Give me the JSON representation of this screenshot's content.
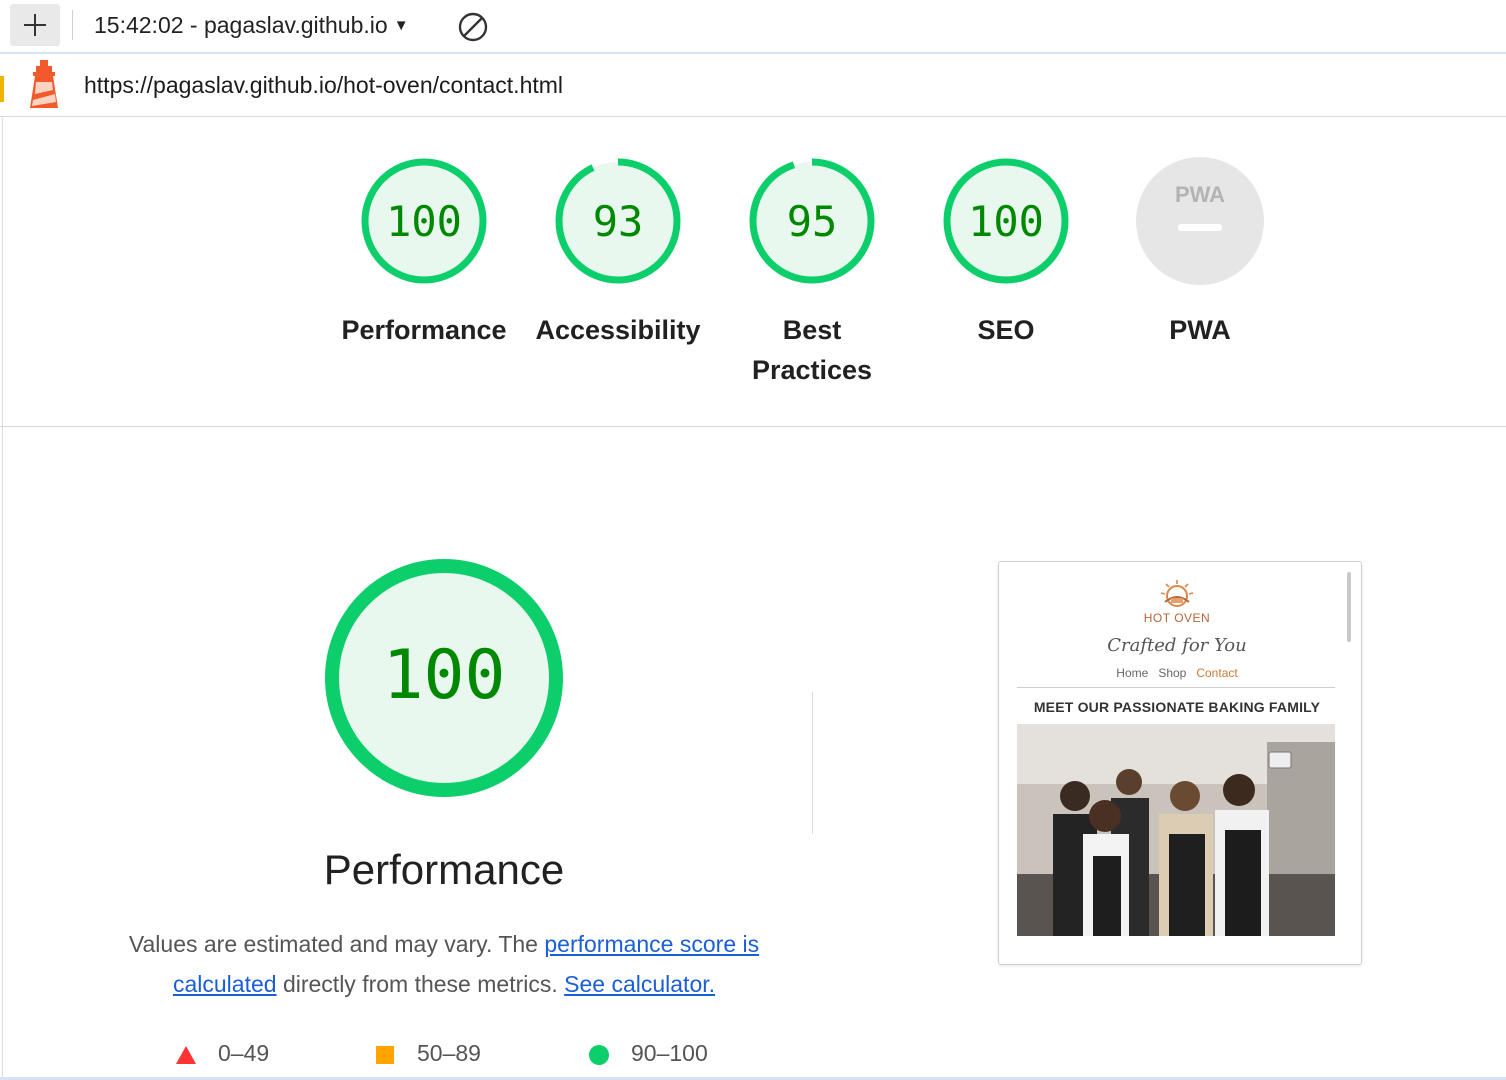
{
  "toolbar": {
    "add_label": "+",
    "report_select": "15:42:02 - pagaslav.github.io",
    "report_caret": "▼"
  },
  "url": {
    "text": "https://pagaslav.github.io/hot-oven/contact.html"
  },
  "colors": {
    "pass": "#0cce6b",
    "pass_text": "#008800",
    "pass_fill": "#e8f8ee",
    "average": "#ffa400",
    "fail": "#ff3333",
    "na": "#e6e6e6"
  },
  "gauges": [
    {
      "label": "Performance",
      "score": "100",
      "fraction": 1.0
    },
    {
      "label": "Accessibility",
      "score": "93",
      "fraction": 0.93
    },
    {
      "label": "Best Practices",
      "score": "95",
      "fraction": 0.95
    },
    {
      "label": "SEO",
      "score": "100",
      "fraction": 1.0
    },
    {
      "label": "PWA",
      "badge": "PWA",
      "fraction": null
    }
  ],
  "performance": {
    "score": "100",
    "title": "Performance",
    "desc_1": "Values are estimated and may vary. The ",
    "link_1": "performance score is calculated",
    "desc_2": " directly from these metrics. ",
    "link_2": "See calculator."
  },
  "legend": [
    {
      "icon": "triangle-icon",
      "range": "0–49"
    },
    {
      "icon": "square-icon",
      "range": "50–89"
    },
    {
      "icon": "circle-icon",
      "range": "90–100"
    }
  ],
  "screenshot": {
    "brand": "HOT OVEN",
    "tagline": "Crafted for You",
    "nav": [
      "Home",
      "Shop",
      "Contact"
    ],
    "heading": "MEET OUR PASSIONATE BAKING FAMILY"
  }
}
